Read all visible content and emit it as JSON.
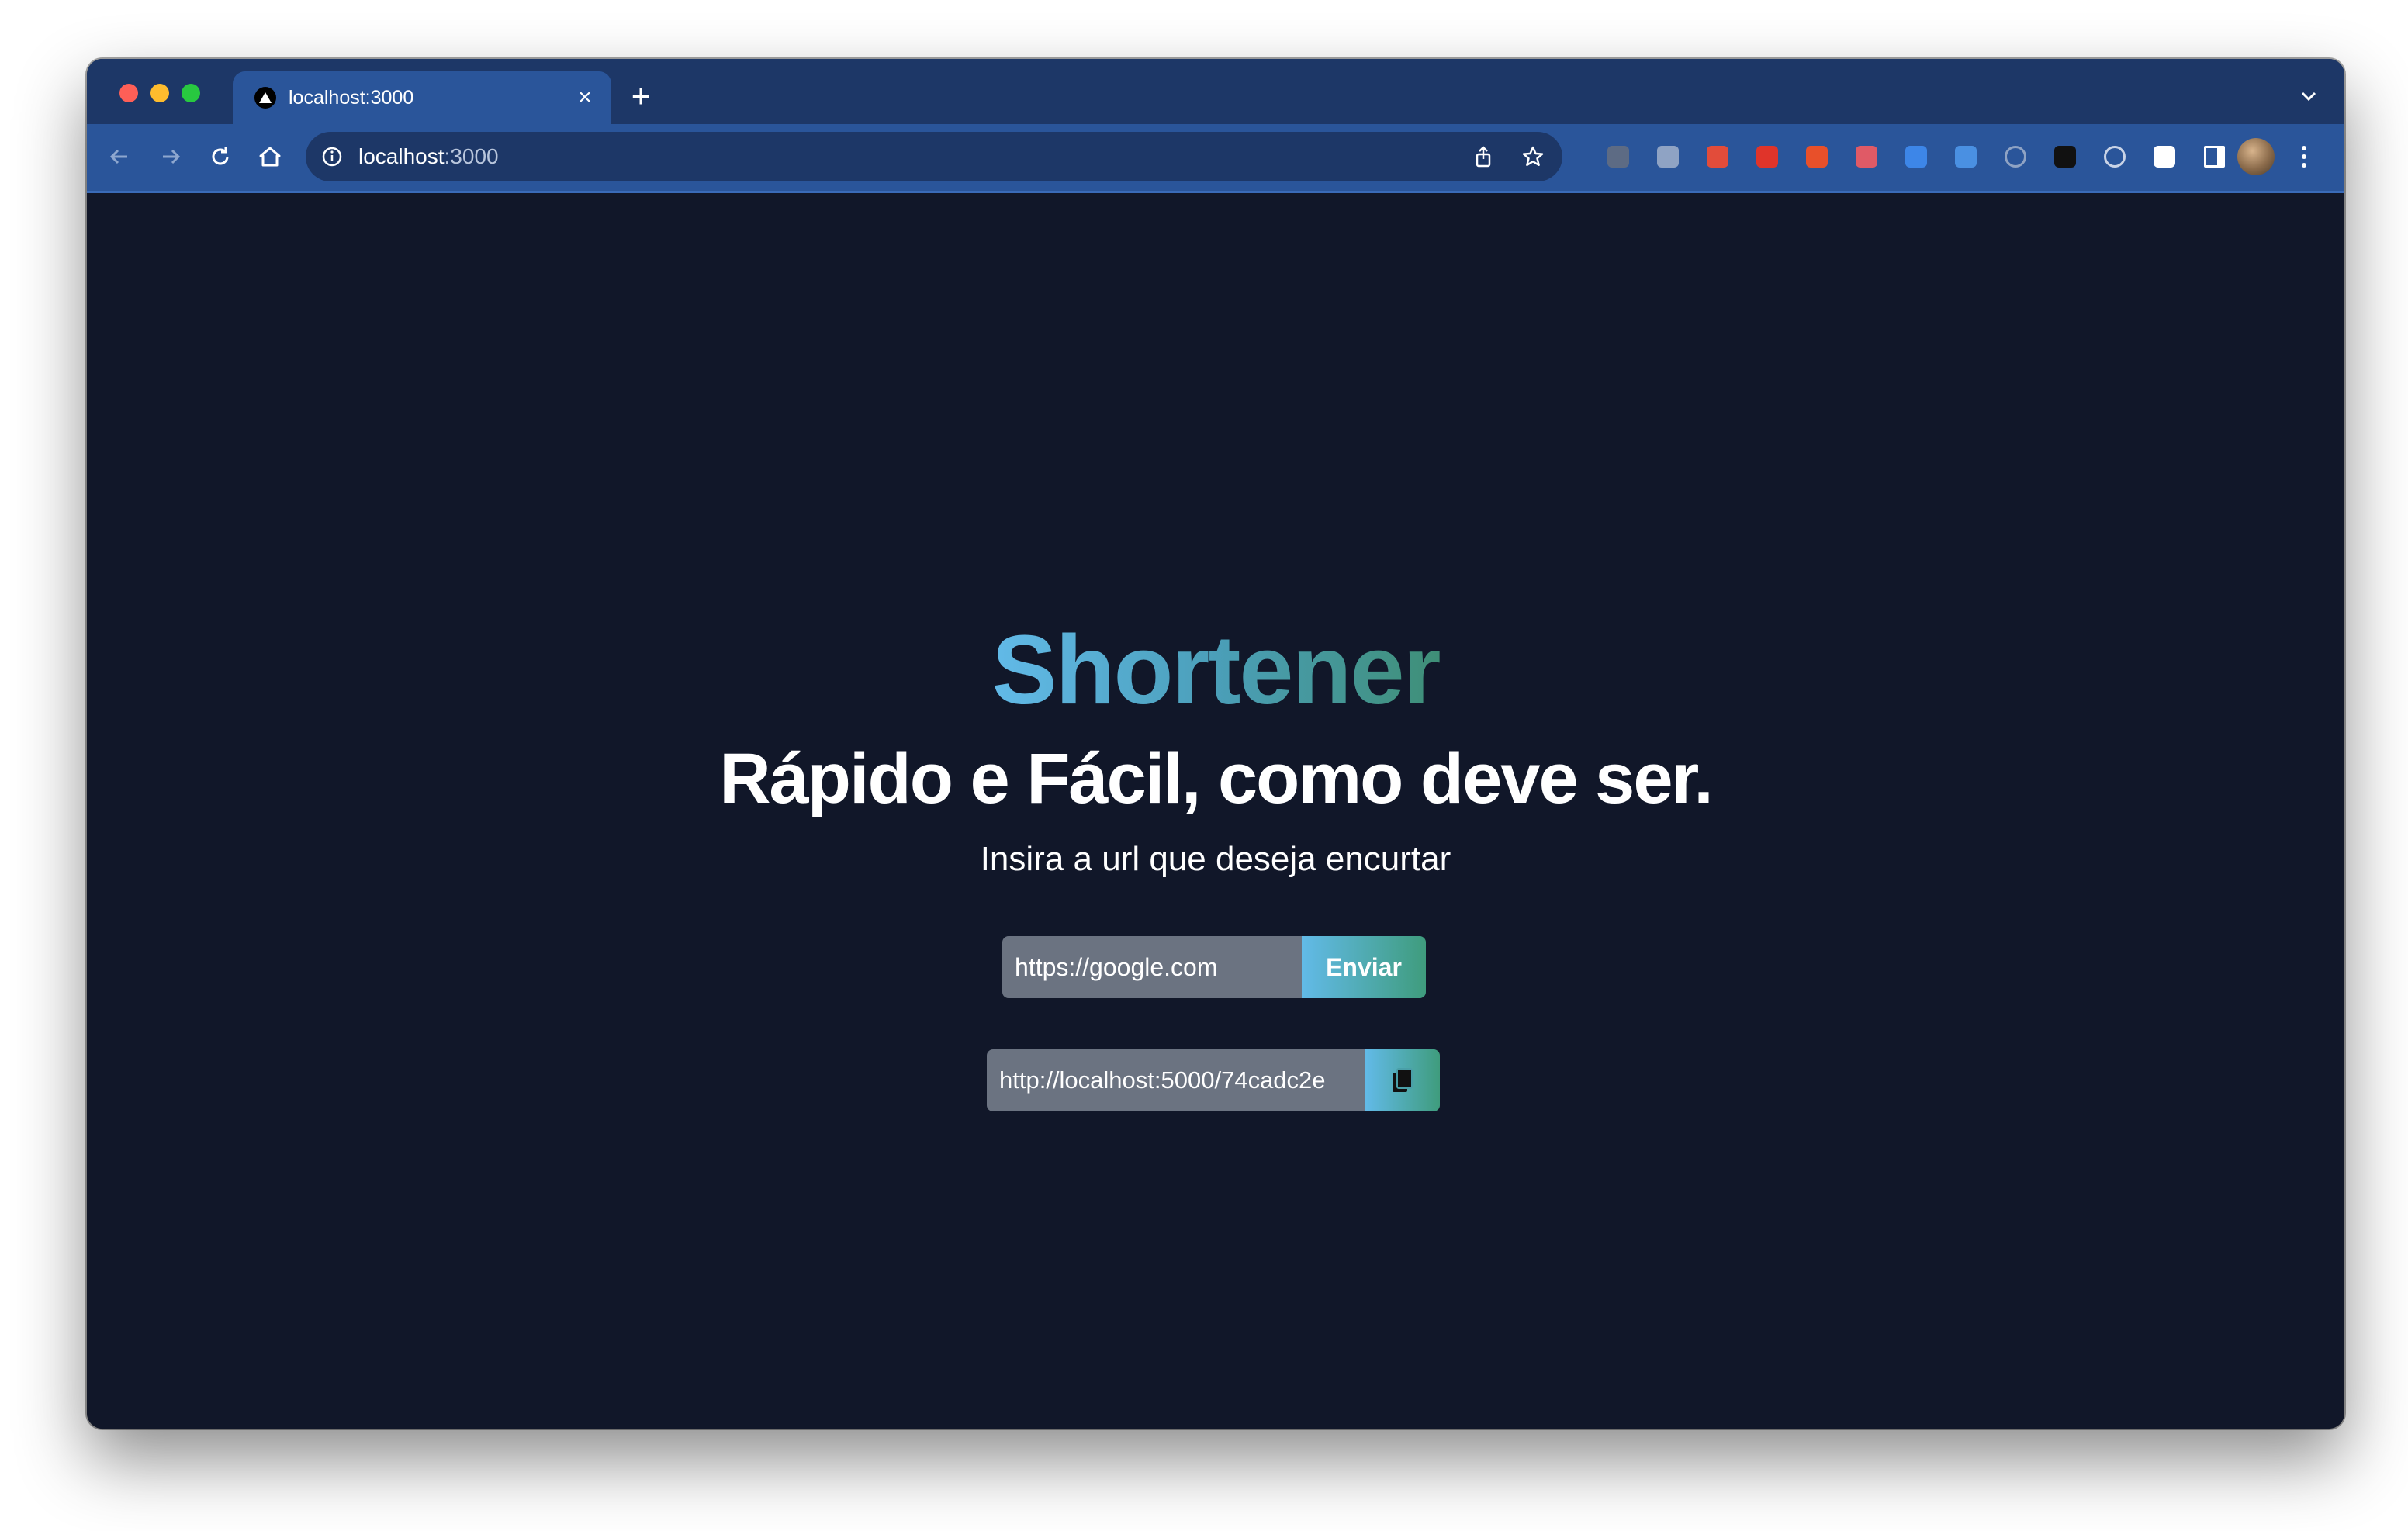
{
  "browser": {
    "tab": {
      "title": "localhost:3000",
      "favicon": "nextjs-triangle-icon",
      "close_label": "×"
    },
    "new_tab_label": "+",
    "address_bar": {
      "host": "localhost",
      "port": ":3000"
    },
    "extensions": [
      {
        "name": "ext-shield-icon",
        "color": "#5d6b84"
      },
      {
        "name": "ext-json-icon",
        "color": "#8fa3c4"
      },
      {
        "name": "ext-bug-icon",
        "color": "#e24c3a"
      },
      {
        "name": "ext-hand-icon",
        "color": "#e0342a"
      },
      {
        "name": "ext-c-icon",
        "color": "#e8502a"
      },
      {
        "name": "ext-window-icon",
        "color": "#e05a66"
      },
      {
        "name": "ext-drive-icon",
        "color": "#3d86e8"
      },
      {
        "name": "ext-translate-icon",
        "color": "#4a90e2"
      },
      {
        "name": "ext-a-icon",
        "color": "#8fa3c4"
      },
      {
        "name": "ext-gnome-icon",
        "color": "#111111"
      },
      {
        "name": "ext-target-icon",
        "color": "#c9d3e6"
      },
      {
        "name": "extensions-puzzle-icon",
        "color": "#ffffff"
      },
      {
        "name": "side-panel-icon",
        "color": "#ffffff"
      }
    ]
  },
  "page": {
    "brand": "Shortener",
    "tagline": "Rápido e Fácil, como deve ser.",
    "subtitle": "Insira a url que deseja encurtar",
    "form": {
      "input_value": "https://google.com",
      "submit_label": "Enviar"
    },
    "result": {
      "short_url": "http://localhost:5000/74cadc2e"
    }
  },
  "colors": {
    "background": "#111729",
    "tab_strip": "#1d3767",
    "toolbar": "#2a559a",
    "input_bg": "#6b7381",
    "gradient_start": "#62bae8",
    "gradient_end": "#3f9c7d"
  }
}
